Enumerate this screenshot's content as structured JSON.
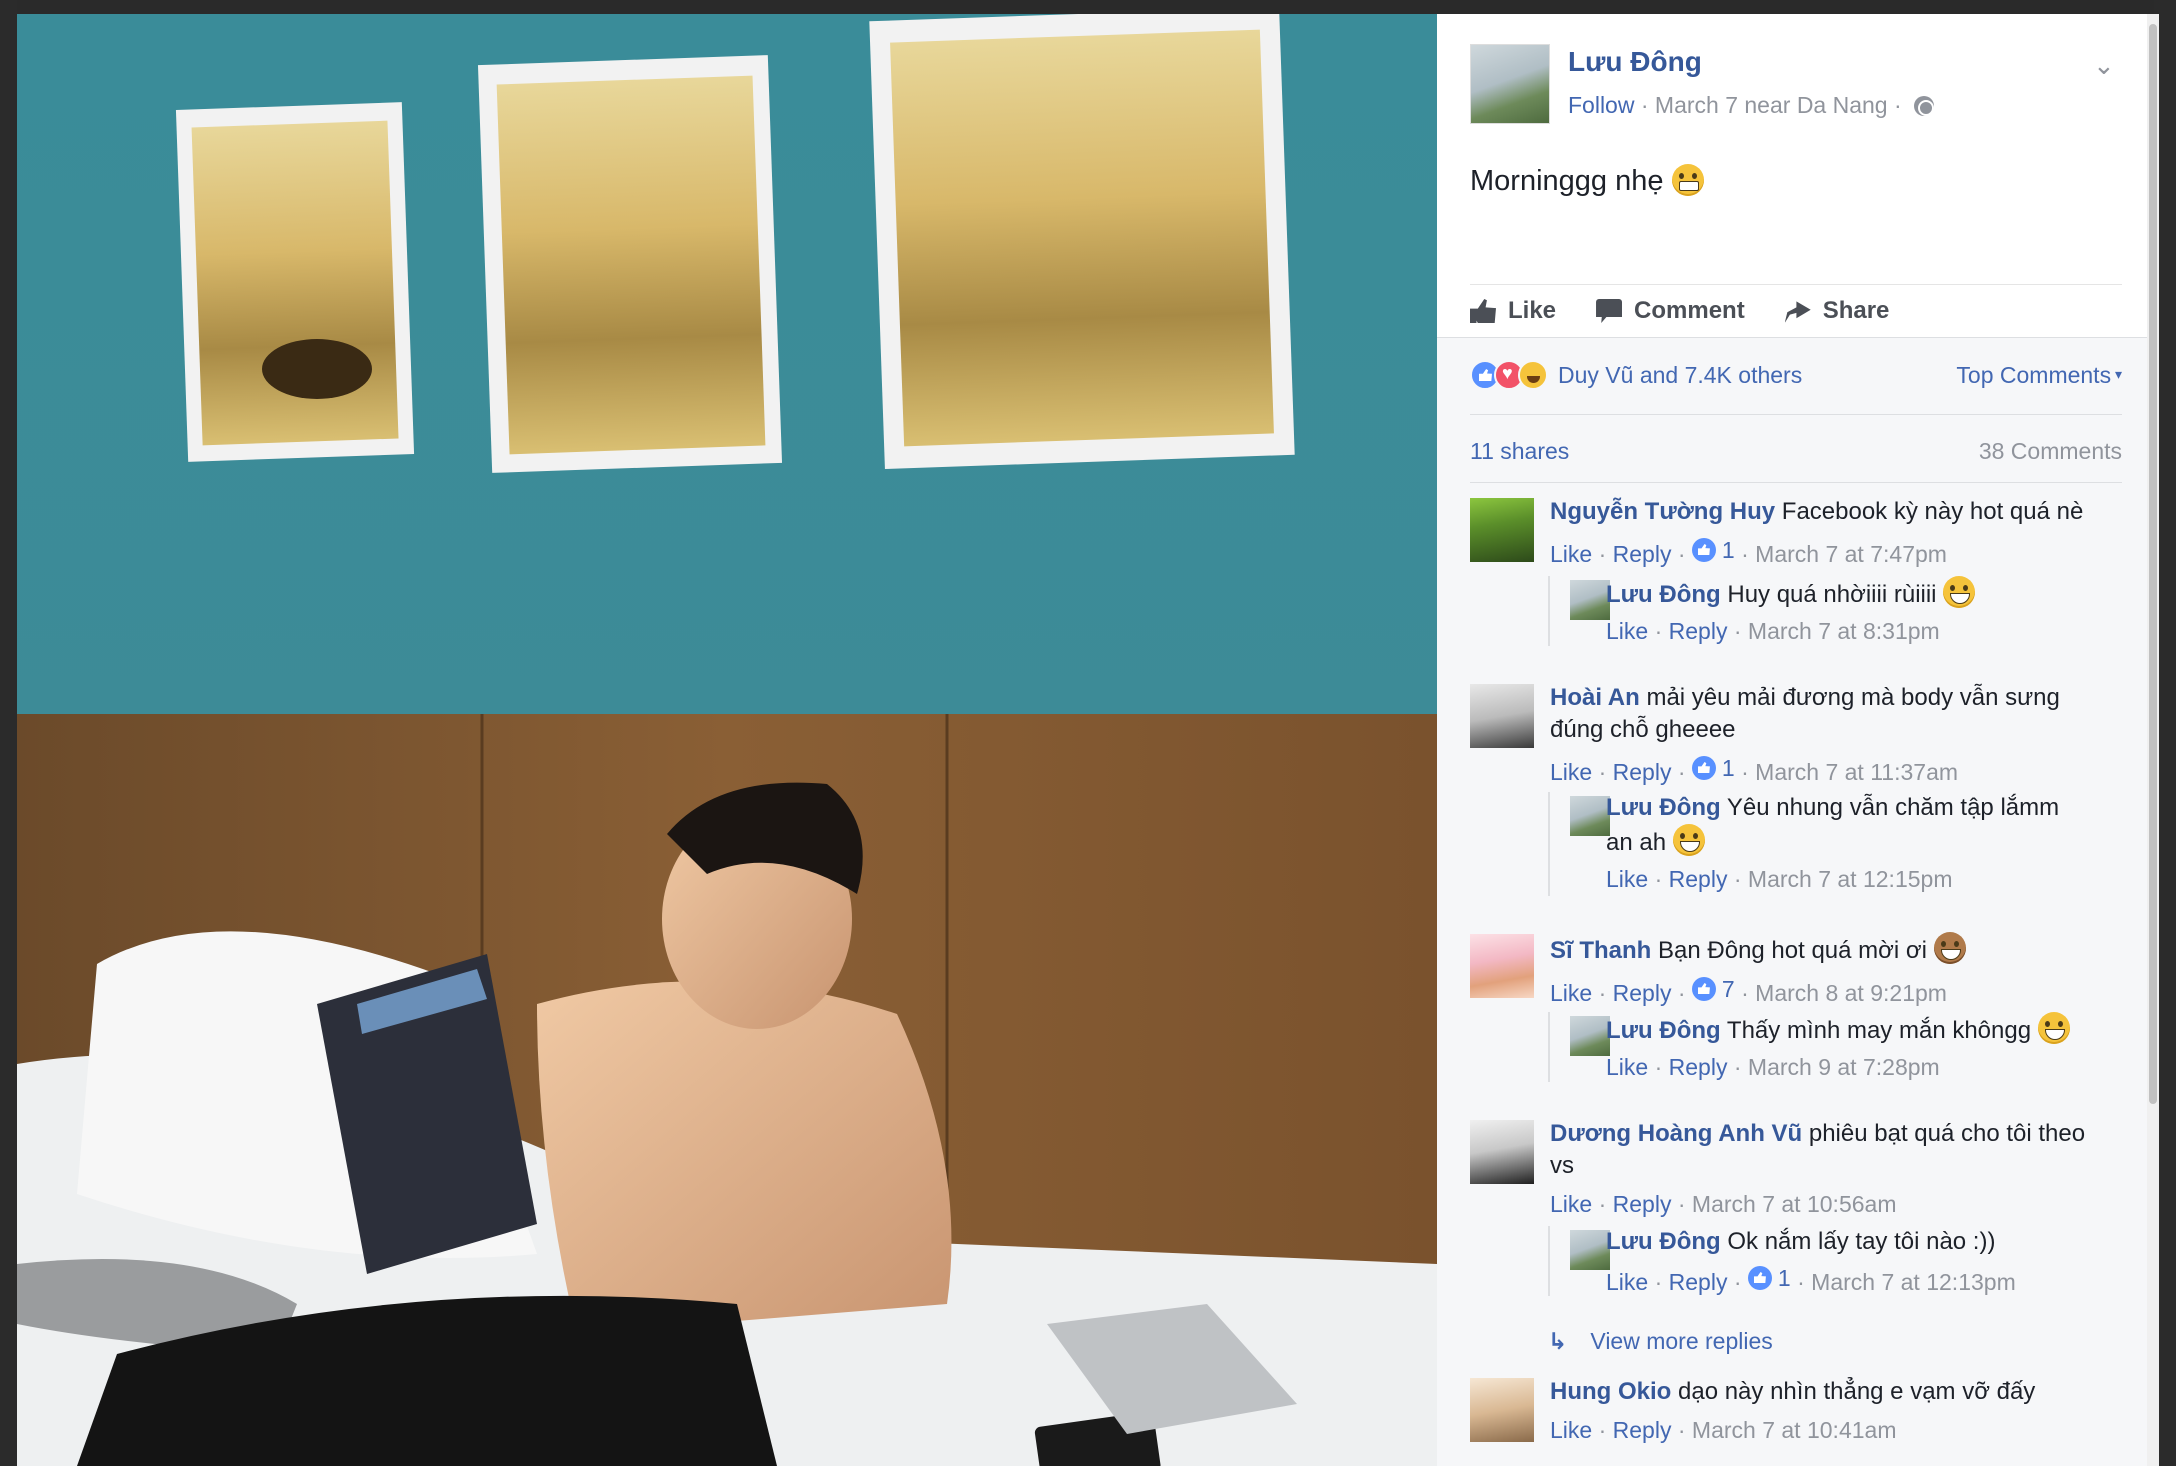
{
  "post": {
    "author": "Lưu Đông",
    "follow_label": "Follow",
    "timestamp": "March 7 near Da Nang",
    "caption": "Morninggg nhẹ",
    "caption_emoji": "grimacing-emoji"
  },
  "actions": {
    "like": "Like",
    "comment": "Comment",
    "share": "Share"
  },
  "reactions": {
    "summary": "Duy Vũ and 7.4K others",
    "icons": [
      "like-reaction-icon",
      "love-reaction-icon",
      "haha-reaction-icon"
    ],
    "sort_label": "Top Comments"
  },
  "counts": {
    "shares": "11 shares",
    "comments": "38 Comments"
  },
  "labels": {
    "like": "Like",
    "reply": "Reply",
    "view_more_replies": "View more replies"
  },
  "comments": [
    {
      "name": "Nguyễn Tường Huy",
      "text": "Facebook kỳ này hot quá nè",
      "likes": "1",
      "time": "March 7 at 7:47pm",
      "reply": {
        "name": "Lưu Đông",
        "text": "Huy quá nhờiiii rùiiii",
        "time": "March 7 at 8:31pm"
      }
    },
    {
      "name": "Hoài An",
      "text": "mải yêu mải đương mà body vẫn sưng đúng chỗ gheeee",
      "likes": "1",
      "time": "March 7 at 11:37am",
      "reply": {
        "name": "Lưu Đông",
        "text": "Yêu nhung vẫn chăm tập lắmm an ah",
        "time": "March 7 at 12:15pm"
      }
    },
    {
      "name": "Sĩ Thanh",
      "text": "Bạn Đông hot quá mời ơi",
      "likes": "7",
      "time": "March 8 at 9:21pm",
      "reply": {
        "name": "Lưu Đông",
        "text": "Thấy mình may mắn khôngg",
        "time": "March 9 at 7:28pm"
      }
    },
    {
      "name": "Dương Hoàng Anh Vũ",
      "text": "phiêu bạt quá cho tôi theo vs",
      "time": "March 7 at 10:56am",
      "reply": {
        "name": "Lưu Đông",
        "text": "Ok nắm lấy tay tôi nào :))",
        "likes": "1",
        "time": "March 7 at 12:13pm"
      }
    },
    {
      "name": "Hung Okio",
      "text": "dạo này nhìn thẳng e vạm vỡ đấy",
      "time": "March 7 at 10:41am"
    }
  ],
  "colors": {
    "link": "#365899",
    "accent": "#4267b2",
    "meta": "#90949c",
    "panel_bg": "#f6f7f9"
  }
}
